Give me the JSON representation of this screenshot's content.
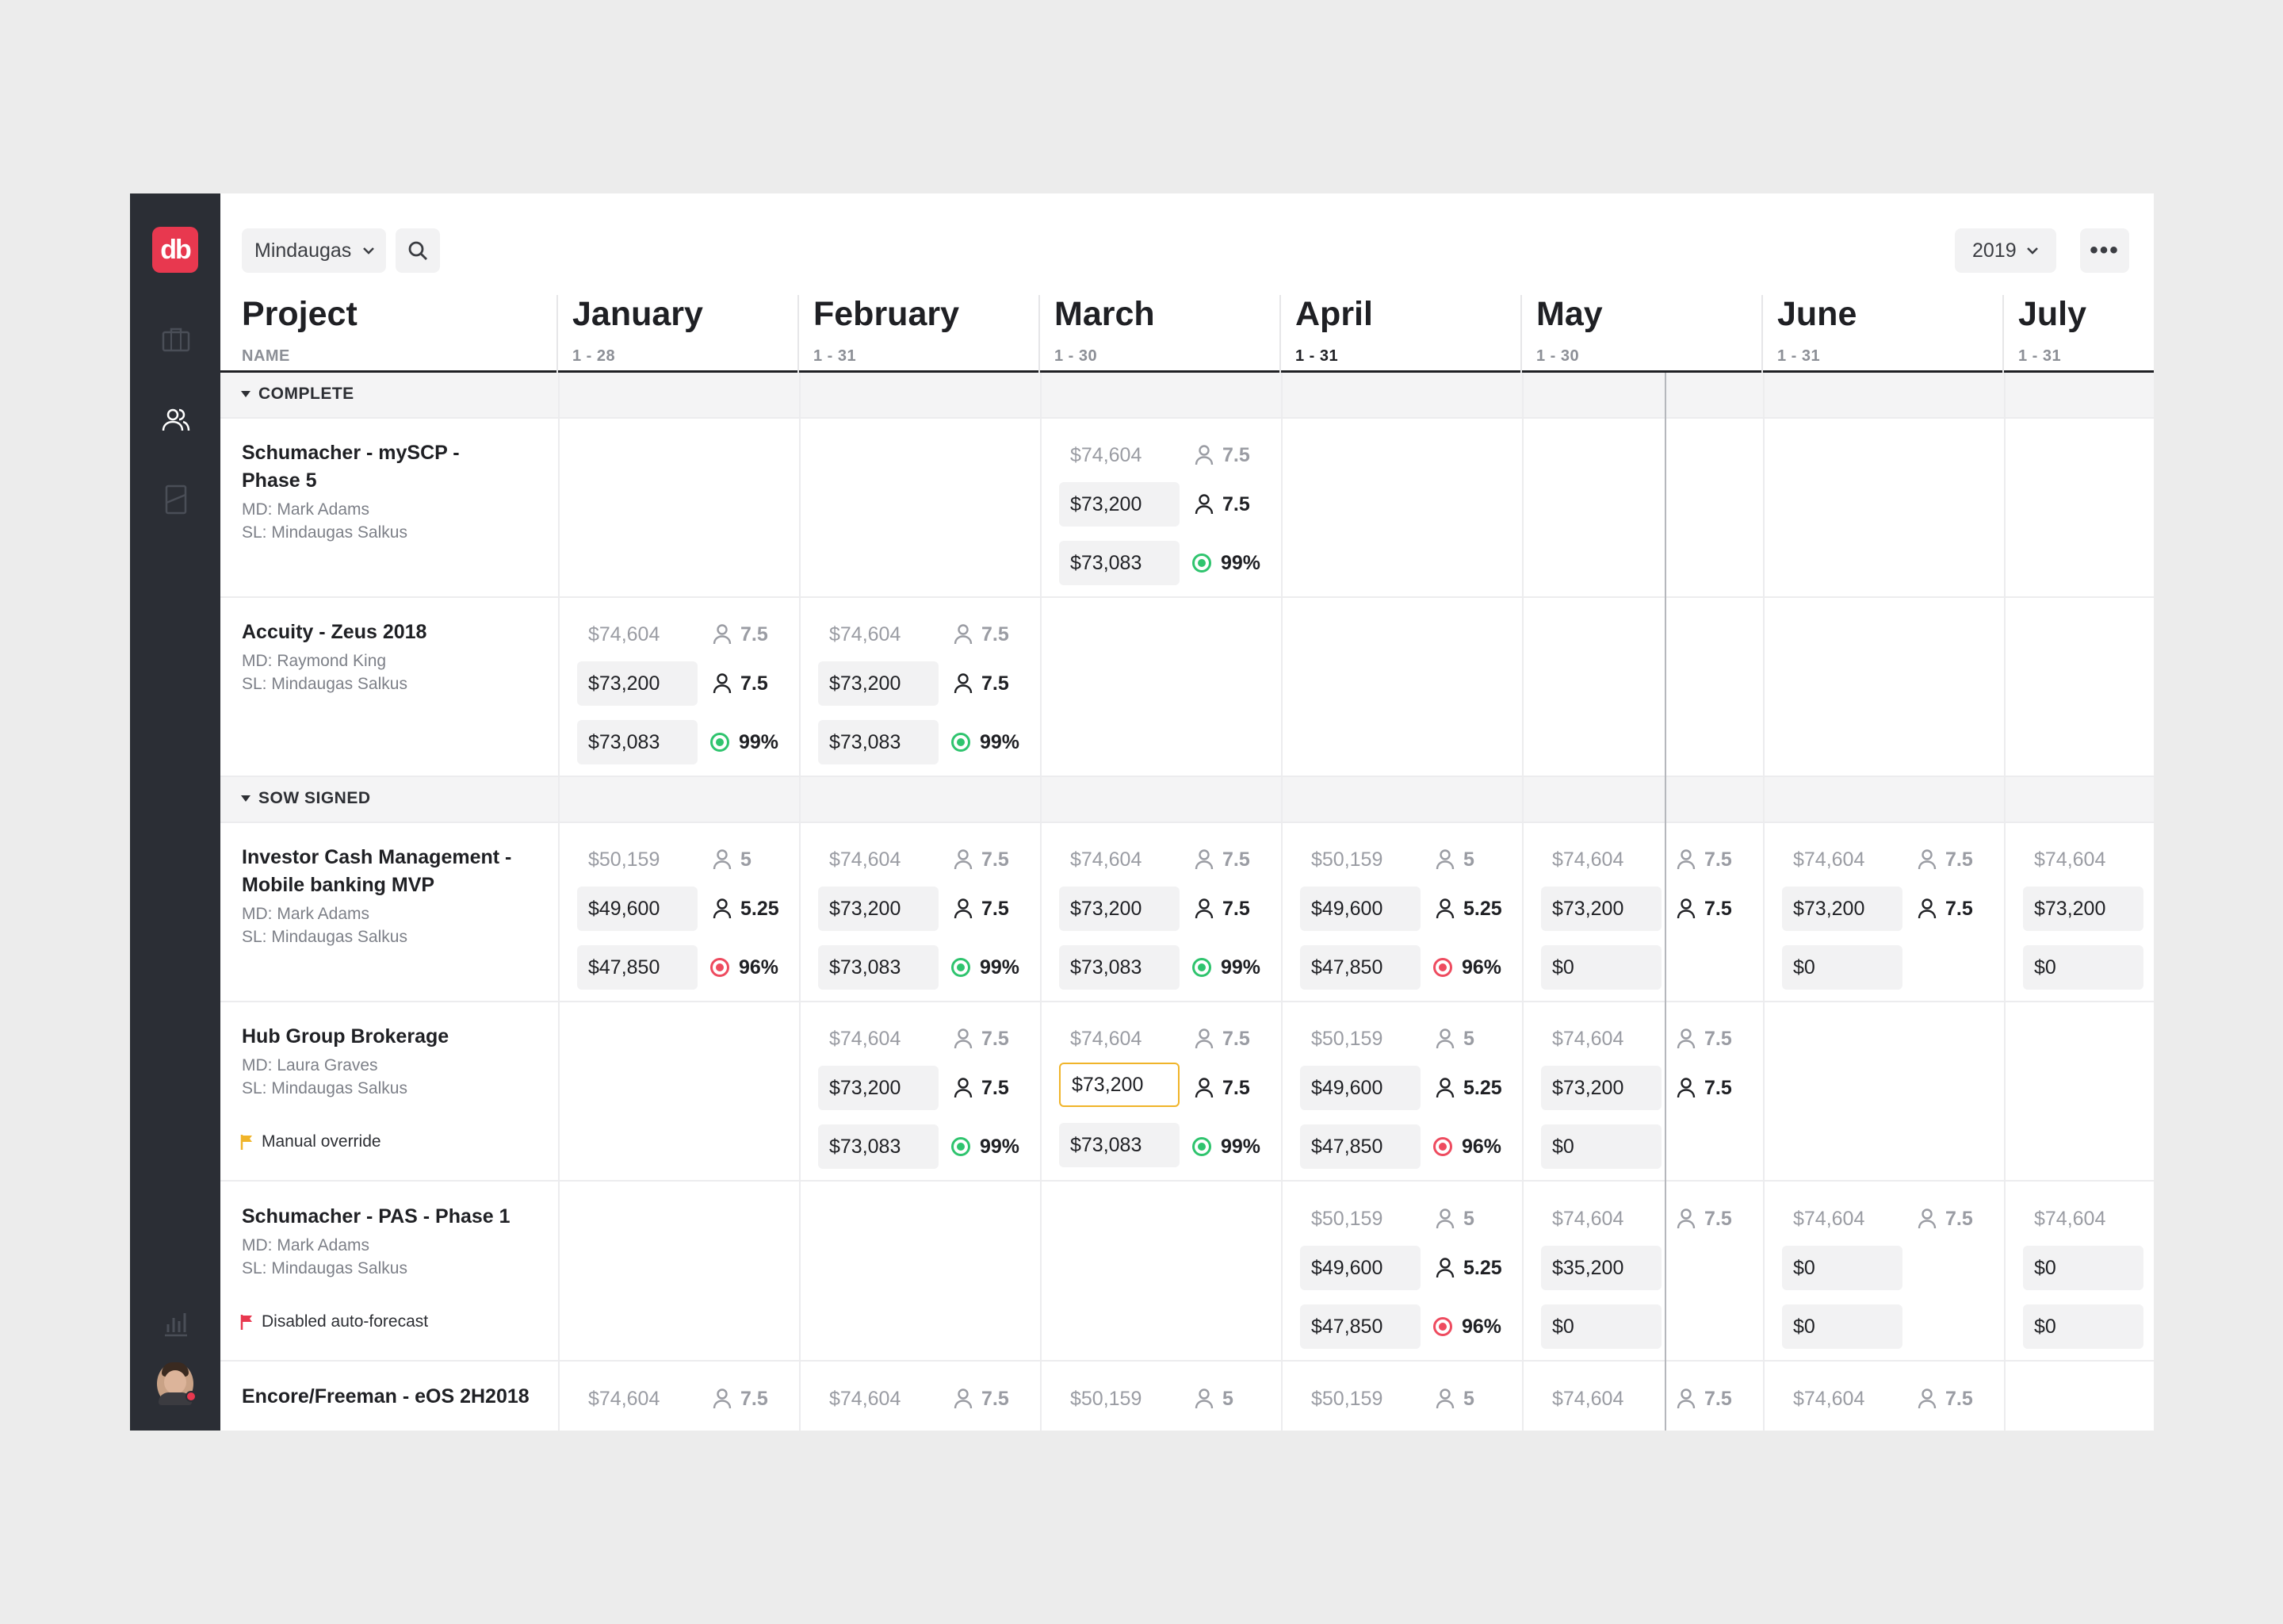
{
  "app": {
    "logo": "db"
  },
  "toolbar": {
    "user": "Mindaugas",
    "year": "2019",
    "more": "•••"
  },
  "header": {
    "project_title": "Project",
    "project_sub": "NAME",
    "months": [
      {
        "name": "January",
        "range": "1 - 28"
      },
      {
        "name": "February",
        "range": "1 - 31"
      },
      {
        "name": "March",
        "range": "1 - 30"
      },
      {
        "name": "April",
        "range": "1 - 31"
      },
      {
        "name": "May",
        "range": "1 - 30"
      },
      {
        "name": "June",
        "range": "1 - 31"
      },
      {
        "name": "July",
        "range": "1 - 31"
      }
    ]
  },
  "groups": [
    {
      "label": "COMPLETE"
    },
    {
      "label": "SOW SIGNED"
    }
  ],
  "projects": [
    {
      "name": "Schumacher - mySCP -\nPhase 5",
      "md": "MD: Mark Adams",
      "sl": "SL: Mindaugas Salkus",
      "months": [
        {
          "m": 2,
          "est": "$74,604",
          "est_people": "7.5",
          "actual": "$73,200",
          "people": "7.5",
          "forecast": "$73,083",
          "pct": "99%",
          "status": "good"
        }
      ]
    },
    {
      "name": "Accuity - Zeus 2018",
      "md": "MD: Raymond King",
      "sl": "SL: Mindaugas Salkus",
      "months": [
        {
          "m": 0,
          "est": "$74,604",
          "est_people": "7.5",
          "actual": "$73,200",
          "people": "7.5",
          "forecast": "$73,083",
          "pct": "99%",
          "status": "good"
        },
        {
          "m": 1,
          "est": "$74,604",
          "est_people": "7.5",
          "actual": "$73,200",
          "people": "7.5",
          "forecast": "$73,083",
          "pct": "99%",
          "status": "good"
        }
      ]
    },
    {
      "name": "Investor Cash Management -\nMobile banking MVP",
      "md": "MD: Mark Adams",
      "sl": "SL: Mindaugas Salkus",
      "months": [
        {
          "m": 0,
          "est": "$50,159",
          "est_people": "5",
          "actual": "$49,600",
          "people": "5.25",
          "forecast": "$47,850",
          "pct": "96%",
          "status": "bad"
        },
        {
          "m": 1,
          "est": "$74,604",
          "est_people": "7.5",
          "actual": "$73,200",
          "people": "7.5",
          "forecast": "$73,083",
          "pct": "99%",
          "status": "good"
        },
        {
          "m": 2,
          "est": "$74,604",
          "est_people": "7.5",
          "actual": "$73,200",
          "people": "7.5",
          "forecast": "$73,083",
          "pct": "99%",
          "status": "good"
        },
        {
          "m": 3,
          "est": "$50,159",
          "est_people": "5",
          "actual": "$49,600",
          "people": "5.25",
          "forecast": "$47,850",
          "pct": "96%",
          "status": "bad"
        },
        {
          "m": 4,
          "est": "$74,604",
          "est_people": "7.5",
          "actual": "$73,200",
          "people": "7.5",
          "forecast": "$0"
        },
        {
          "m": 5,
          "est": "$74,604",
          "est_people": "7.5",
          "actual": "$73,200",
          "people": "7.5",
          "forecast": "$0"
        },
        {
          "m": 6,
          "est": "$74,604",
          "actual": "$73,200",
          "forecast": "$0"
        }
      ]
    },
    {
      "name": "Hub Group Brokerage",
      "md": "MD: Laura Graves",
      "sl": "SL: Mindaugas Salkus",
      "note": "Manual override",
      "note_color": "#f0b429",
      "months": [
        {
          "m": 1,
          "est": "$74,604",
          "est_people": "7.5",
          "actual": "$73,200",
          "people": "7.5",
          "forecast": "$73,083",
          "pct": "99%",
          "status": "good"
        },
        {
          "m": 2,
          "est": "$74,604",
          "est_people": "7.5",
          "actual": "$73,200",
          "people": "7.5",
          "forecast": "$73,083",
          "pct": "99%",
          "status": "good",
          "selected": true
        },
        {
          "m": 3,
          "est": "$50,159",
          "est_people": "5",
          "actual": "$49,600",
          "people": "5.25",
          "forecast": "$47,850",
          "pct": "96%",
          "status": "bad"
        },
        {
          "m": 4,
          "est": "$74,604",
          "est_people": "7.5",
          "actual": "$73,200",
          "people": "7.5",
          "forecast": "$0"
        }
      ]
    },
    {
      "name": "Schumacher - PAS - Phase 1",
      "md": "MD: Mark Adams",
      "sl": "SL: Mindaugas Salkus",
      "note": "Disabled auto-forecast",
      "note_color": "#e8384f",
      "months": [
        {
          "m": 3,
          "est": "$50,159",
          "est_people": "5",
          "actual": "$49,600",
          "people": "5.25",
          "forecast": "$47,850",
          "pct": "96%",
          "status": "bad"
        },
        {
          "m": 4,
          "est": "$74,604",
          "est_people": "7.5",
          "actual": "$35,200",
          "forecast": "$0"
        },
        {
          "m": 5,
          "est": "$74,604",
          "est_people": "7.5",
          "actual": "$0",
          "forecast": "$0"
        },
        {
          "m": 6,
          "est": "$74,604",
          "actual": "$0",
          "forecast": "$0"
        }
      ]
    },
    {
      "name": "Encore/Freeman - eOS 2H2018",
      "months": [
        {
          "m": 0,
          "est": "$74,604",
          "est_people": "7.5"
        },
        {
          "m": 1,
          "est": "$74,604",
          "est_people": "7.5"
        },
        {
          "m": 2,
          "est": "$50,159",
          "est_people": "5"
        },
        {
          "m": 3,
          "est": "$50,159",
          "est_people": "5"
        },
        {
          "m": 4,
          "est": "$74,604",
          "est_people": "7.5"
        },
        {
          "m": 5,
          "est": "$74,604",
          "est_people": "7.5"
        }
      ]
    }
  ]
}
